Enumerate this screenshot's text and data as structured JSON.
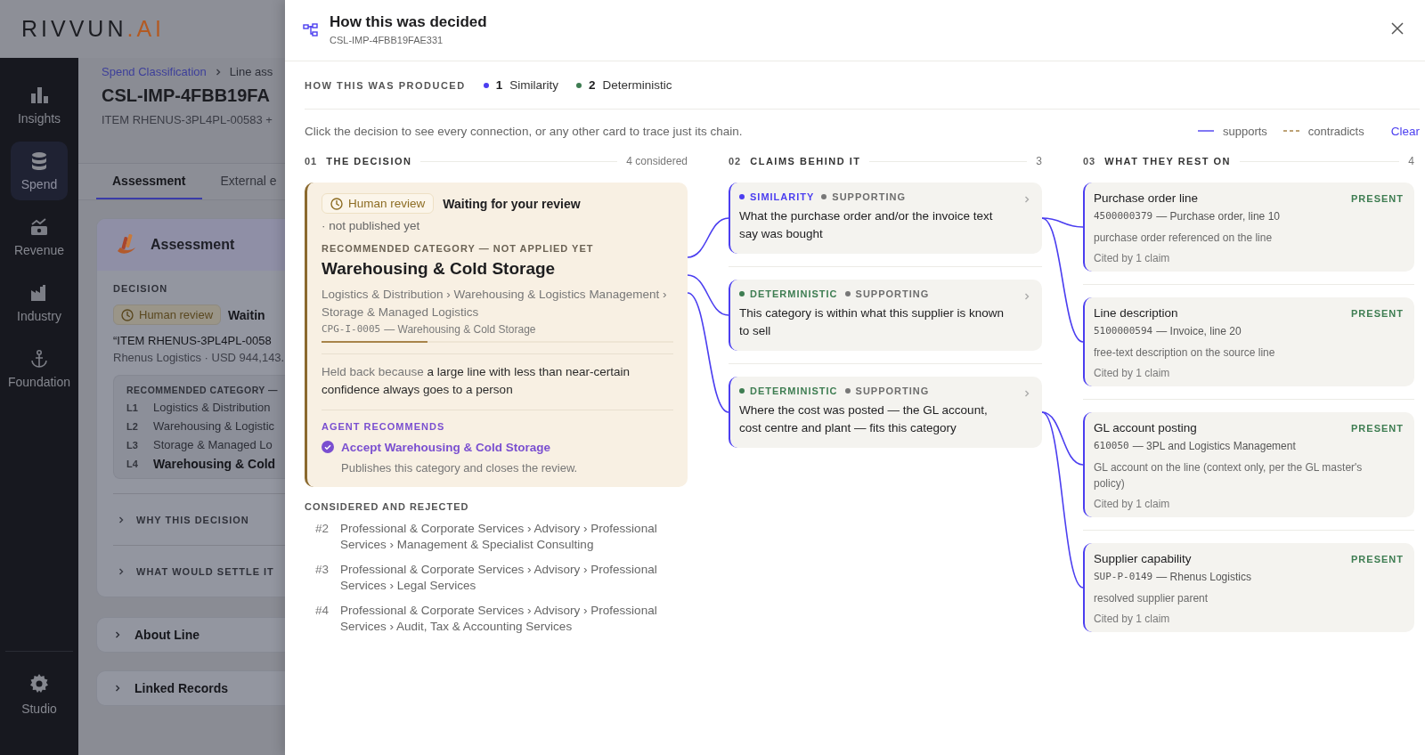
{
  "app": {
    "logo": {
      "main": "RIVVUN",
      "accent": ".AI"
    },
    "nav": [
      {
        "label": "Insights",
        "selected": false
      },
      {
        "label": "Spend",
        "selected": true
      },
      {
        "label": "Revenue",
        "selected": false
      },
      {
        "label": "Industry",
        "selected": false
      },
      {
        "label": "Foundation",
        "selected": false
      }
    ],
    "nav_footer": {
      "label": "Studio"
    }
  },
  "page": {
    "breadcrumb": [
      {
        "label": "Spend Classification"
      },
      {
        "label": "Line ass"
      }
    ],
    "title": "CSL-IMP-4FBB19FA",
    "subtitle": "ITEM RHENUS-3PL4PL-00583 +",
    "tabs": [
      {
        "label": "Assessment",
        "selected": true
      },
      {
        "label": "External e",
        "selected": false
      }
    ],
    "assessment": {
      "title": "Assessment",
      "decision_label": "DECISION",
      "badge": "Human review",
      "status": "Waitin",
      "quote": "“ITEM RHENUS-3PL4PL-0058",
      "meta": "Rhenus Logistics · USD 944,143.",
      "category_heading": "RECOMMENDED CATEGORY —",
      "levels": [
        {
          "code": "L1",
          "label": "Logistics & Distribution"
        },
        {
          "code": "L2",
          "label": "Warehousing & Logistic"
        },
        {
          "code": "L3",
          "label": "Storage & Managed Lo"
        },
        {
          "code": "L4",
          "label": "Warehousing & Cold"
        }
      ],
      "sections": [
        {
          "label": "WHY THIS DECISION",
          "expanded": false
        },
        {
          "label": "WHAT WOULD SETTLE IT",
          "expanded": false
        }
      ]
    },
    "panels": [
      {
        "label": "About Line",
        "expanded": false
      },
      {
        "label": "Linked Records",
        "expanded": false
      }
    ]
  },
  "trace": {
    "title": "How this was decided",
    "subtitle": "CSL-IMP-4FBB19FAE331",
    "produced": {
      "label": "HOW THIS WAS PRODUCED",
      "methods": [
        {
          "kind": "similarity",
          "count": "1",
          "label": "Similarity"
        },
        {
          "kind": "deterministic",
          "count": "2",
          "label": "Deterministic"
        }
      ]
    },
    "hint": "Click the decision to see every connection, or any other card to trace just its chain.",
    "legend": [
      {
        "kind": "supports",
        "label": "supports"
      },
      {
        "kind": "contradicts",
        "label": "contradicts"
      }
    ],
    "clear": "Clear",
    "columns": [
      {
        "number": "01",
        "title": "THE DECISION",
        "count": "4 considered"
      },
      {
        "number": "02",
        "title": "CLAIMS BEHIND IT",
        "count": "3"
      },
      {
        "number": "03",
        "title": "WHAT THEY REST ON",
        "count": "4"
      }
    ],
    "decision": {
      "badge": "Human review",
      "status": "Waiting for your review",
      "note": "· not published yet",
      "heading": "RECOMMENDED CATEGORY — NOT APPLIED YET",
      "category": "Warehousing & Cold Storage",
      "path": "Logistics & Distribution › Warehousing & Logistics Management › Storage & Managed Logistics",
      "code": "CPG-I-0005",
      "code_label": "— Warehousing & Cold Storage",
      "confidence": {
        "level": 0.3
      },
      "reason": "Held back because **a large line with less than near-certain confidence always goes to a person**",
      "agent_heading": "AGENT RECOMMENDS",
      "action": "Accept Warehousing & Cold Storage",
      "action_note": "Publishes this category and closes the review."
    },
    "considered": {
      "heading": "CONSIDERED AND REJECTED",
      "items": [
        {
          "rank": "#2",
          "path": "Professional & Corporate Services › Advisory › Professional Services › Management & Specialist Consulting"
        },
        {
          "rank": "#3",
          "path": "Professional & Corporate Services › Advisory › Professional Services › Legal Services"
        },
        {
          "rank": "#4",
          "path": "Professional & Corporate Services › Advisory › Professional Services › Audit, Tax & Accounting Services"
        }
      ]
    },
    "claims": [
      {
        "kind": "similarity",
        "method": "SIMILARITY",
        "stance": "SUPPORTING",
        "text": "What the purchase order and/or the invoice text say was bought"
      },
      {
        "kind": "deterministic",
        "method": "DETERMINISTIC",
        "stance": "SUPPORTING",
        "text": "This category is within what this supplier is known to sell"
      },
      {
        "kind": "deterministic",
        "method": "DETERMINISTIC",
        "stance": "SUPPORTING",
        "text": "Where the cost was posted — the GL account, cost centre and plant — fits this category"
      }
    ],
    "evidence": [
      {
        "title": "Purchase order line",
        "status": "PRESENT",
        "ref_id": "4500000379",
        "ref_label": "— Purchase order, line 10",
        "note": "purchase order referenced on the line",
        "cited": "Cited by 1 claim"
      },
      {
        "title": "Line description",
        "status": "PRESENT",
        "ref_id": "5100000594",
        "ref_label": "— Invoice, line 20",
        "note": "free-text description on the source line",
        "cited": "Cited by 1 claim"
      },
      {
        "title": "GL account posting",
        "status": "PRESENT",
        "ref_id": "610050",
        "ref_label": "— 3PL and Logistics Management",
        "note": "GL account on the line (context only, per the GL master's policy)",
        "cited": "Cited by 1 claim"
      },
      {
        "title": "Supplier capability",
        "status": "PRESENT",
        "ref_id": "SUP-P-0149",
        "ref_label": "— Rhenus Logistics",
        "note": "resolved supplier parent",
        "cited": "Cited by 1 claim"
      }
    ]
  }
}
